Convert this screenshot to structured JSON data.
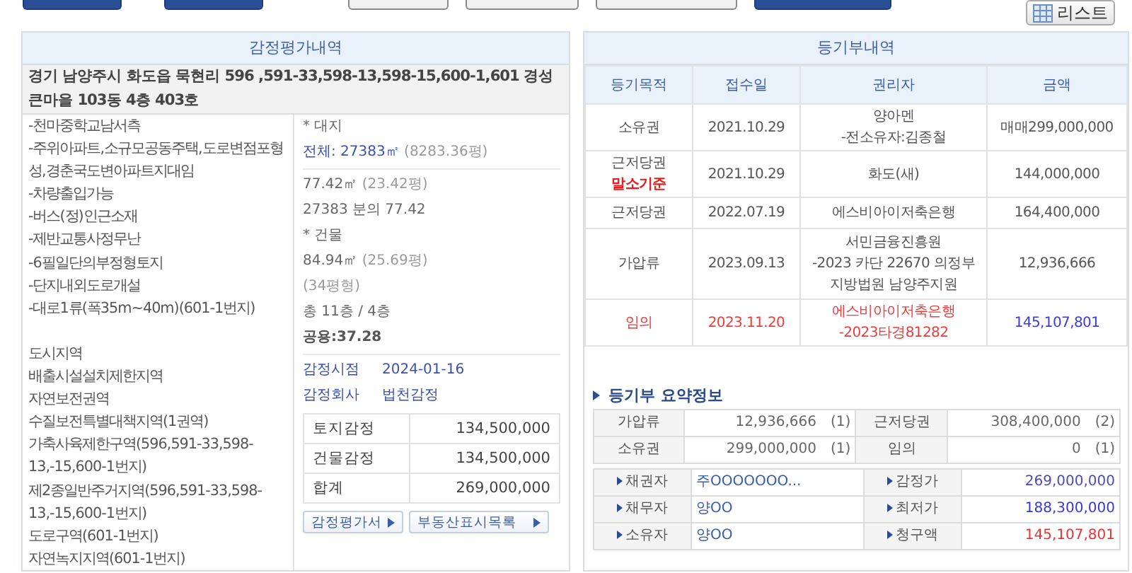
{
  "top_buttons": [
    {
      "kind": "blue"
    },
    {
      "kind": "blue"
    },
    {
      "kind": "gray"
    },
    {
      "kind": "gray"
    },
    {
      "kind": "gray"
    },
    {
      "kind": "blue"
    }
  ],
  "list_button": {
    "label": "리스트"
  },
  "appraisal": {
    "title": "감정평가내역",
    "address": "경기 남양주시 화도읍 묵현리 596 ,591-33,598-13,598-15,600-1,601 경성큰마을 103동 4층 403호",
    "features": [
      "-천마중학교남서측",
      "-주위아파트,소규모공동주택,도로변점포형성,경춘국도변아파트지대임",
      "-차량출입가능",
      "-버스(정)인근소재",
      "-제반교통사정무난",
      "-6필일단의부정형토지",
      "-단지내외도로개설",
      "-대로1류(폭35m~40m)(601-1번지)"
    ],
    "zoning": [
      "도시지역",
      "배출시설설치제한지역",
      "자연보전권역",
      "수질보전특별대책지역(1권역)",
      "가축사육제한구역(596,591-33,598-13,-15,600-1번지)",
      "제2종일반주거지역(596,591-33,598-13,-15,600-1번지)",
      "도로구역(601-1번지)",
      "자연녹지지역(601-1번지)"
    ],
    "land": {
      "heading": "* 대지",
      "total": "전체: 27383㎡",
      "total_pyeong": "(8283.36평)",
      "area": "77.42㎡",
      "area_pyeong": "(23.42평)",
      "share": "27383 분의 77.42"
    },
    "building": {
      "heading": "* 건물",
      "area": "84.94㎡",
      "area_pyeong": "(25.69평)",
      "type": "(34평형)",
      "floors": "총 11층 / 4층",
      "common": "공용:37.28"
    },
    "info": [
      {
        "label": "감정시점",
        "value": "2024-01-16"
      },
      {
        "label": "감정회사",
        "value": "법천감정"
      }
    ],
    "amounts": [
      {
        "label": "토지감정",
        "value": "134,500,000"
      },
      {
        "label": "건물감정",
        "value": "134,500,000"
      },
      {
        "label": "합계",
        "value": "269,000,000"
      }
    ],
    "buttons": [
      "감정평가서",
      "부동산표시목록"
    ]
  },
  "registry": {
    "title": "등기부내역",
    "columns": [
      "등기목적",
      "접수일",
      "권리자",
      "금액"
    ],
    "rows": [
      {
        "purpose": "소유권",
        "date": "2021.10.29",
        "holder": [
          "양아멘",
          "-전소유자:김종철"
        ],
        "amount": "매매299,000,000",
        "highlight": false
      },
      {
        "purpose": "근저당권",
        "note": "말소기준",
        "date": "2021.10.29",
        "holder": [
          "화도(새)"
        ],
        "amount": "144,000,000",
        "highlight": false
      },
      {
        "purpose": "근저당권",
        "date": "2022.07.19",
        "holder": [
          "에스비아이저축은행"
        ],
        "amount": "164,400,000",
        "highlight": false
      },
      {
        "purpose": "가압류",
        "date": "2023.09.13",
        "holder": [
          "서민금융진흥원",
          "-2023 카단 22670 의정부",
          "지방법원 남양주지원"
        ],
        "amount": "12,936,666",
        "highlight": false
      },
      {
        "purpose": "임의",
        "date": "2023.11.20",
        "holder": [
          "에스비아이저축은행",
          "-2023타경81282"
        ],
        "amount": "145,107,801",
        "highlight": true
      }
    ]
  },
  "summary": {
    "title": "등기부 요약정보",
    "counts": [
      [
        {
          "label": "가압류",
          "amount": "12,936,666",
          "count": "(1)"
        },
        {
          "label": "근저당권",
          "amount": "308,400,000",
          "count": "(2)"
        }
      ],
      [
        {
          "label": "소유권",
          "amount": "299,000,000",
          "count": "(1)"
        },
        {
          "label": "임의",
          "amount": "0",
          "count": "(1)"
        }
      ]
    ],
    "details": [
      [
        {
          "label": "채권자",
          "value": "주OOOOOOO...",
          "color": "#3a5fb0"
        },
        {
          "label": "감정가",
          "value": "269,000,000",
          "color": "#4a4ab8"
        }
      ],
      [
        {
          "label": "채무자",
          "value": "양OO",
          "color": "#3a5fb0"
        },
        {
          "label": "최저가",
          "value": "188,300,000",
          "color": "#3434e0"
        }
      ],
      [
        {
          "label": "소유자",
          "value": "양OO",
          "color": "#3a5fb0"
        },
        {
          "label": "청구액",
          "value": "145,107,801",
          "color": "#f03030"
        }
      ]
    ]
  }
}
